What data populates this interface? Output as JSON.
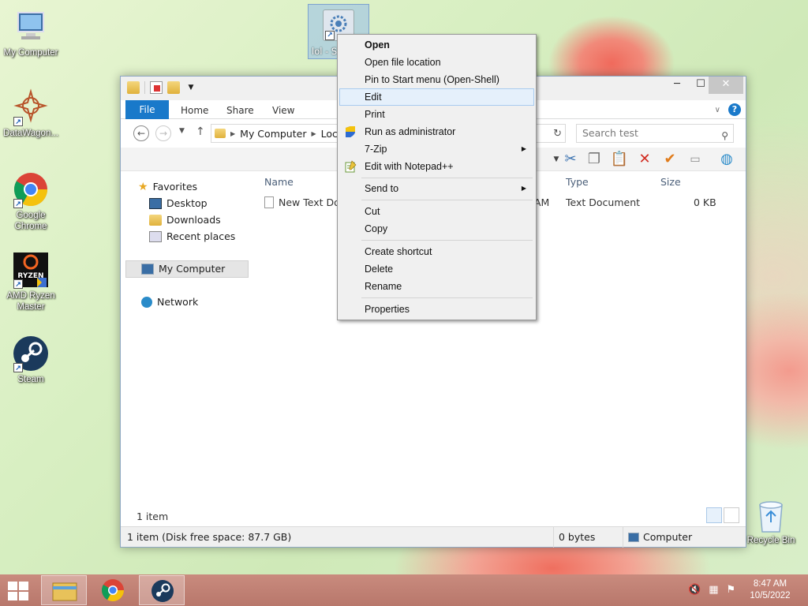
{
  "desktop": {
    "icons": [
      {
        "label": "My Computer"
      },
      {
        "label": "DataWagon..."
      },
      {
        "label": "Google Chrome"
      },
      {
        "label": "AMD Ryzen Master"
      },
      {
        "label": "Steam"
      }
    ],
    "selected_icon_label": "lol - S",
    "recycle_bin_label": "Recycle Bin"
  },
  "explorer": {
    "ribbon_tabs": [
      "File",
      "Home",
      "Share",
      "View"
    ],
    "address": {
      "crumb1": "My Computer",
      "crumb2": "Loca"
    },
    "search_placeholder": "Search test",
    "nav": {
      "favorites": "Favorites",
      "desktop": "Desktop",
      "downloads": "Downloads",
      "recent": "Recent places",
      "my_computer": "My Computer",
      "network": "Network"
    },
    "columns": {
      "name": "Name",
      "type": "Type",
      "size": "Size"
    },
    "rows": [
      {
        "name": "New Text Doc",
        "time_fragment": "AM",
        "type": "Text Document",
        "size": "0 KB"
      }
    ],
    "item_count": "1 item",
    "statusbar": {
      "left": "1 item (Disk free space: 87.7 GB)",
      "bytes": "0 bytes",
      "location": "Computer"
    }
  },
  "context_menu": {
    "items": [
      {
        "label": "Open"
      },
      {
        "label": "Open file location"
      },
      {
        "label": "Pin to Start menu (Open-Shell)"
      },
      {
        "label": "Edit"
      },
      {
        "label": "Print"
      },
      {
        "label": "Run as administrator"
      },
      {
        "label": "7-Zip"
      },
      {
        "label": "Edit with Notepad++"
      },
      {
        "label": "Send to"
      },
      {
        "label": "Cut"
      },
      {
        "label": "Copy"
      },
      {
        "label": "Create shortcut"
      },
      {
        "label": "Delete"
      },
      {
        "label": "Rename"
      },
      {
        "label": "Properties"
      }
    ],
    "highlighted": "Edit"
  },
  "taskbar": {
    "clock_time": "8:47 AM",
    "clock_date": "10/5/2022"
  },
  "colors": {
    "accent": "#1979ca",
    "menu_highlight": "#e5f0fb",
    "taskbar": "#c08477"
  }
}
